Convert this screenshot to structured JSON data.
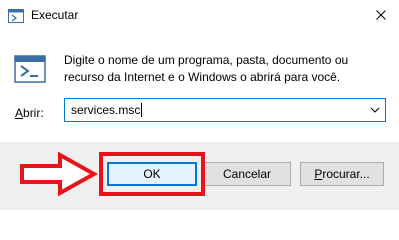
{
  "window": {
    "title": "Executar",
    "description": "Digite o nome de um programa, pasta, documento ou recurso da Internet e o Windows o abrirá para você.",
    "icons": {
      "title": "run-icon",
      "close": "close-icon",
      "body": "run-program-icon",
      "dropdown": "chevron-down-icon"
    }
  },
  "open_field": {
    "label_accel": "A",
    "label_rest": "brir:",
    "value": "services.msc"
  },
  "buttons": {
    "ok": "OK",
    "cancel": "Cancelar",
    "browse_accel": "P",
    "browse_rest": "rocurar..."
  },
  "annotation": {
    "color": "#e8131b"
  },
  "colors": {
    "accent": "#0078d7",
    "footer_bg": "#f0f0f0"
  }
}
